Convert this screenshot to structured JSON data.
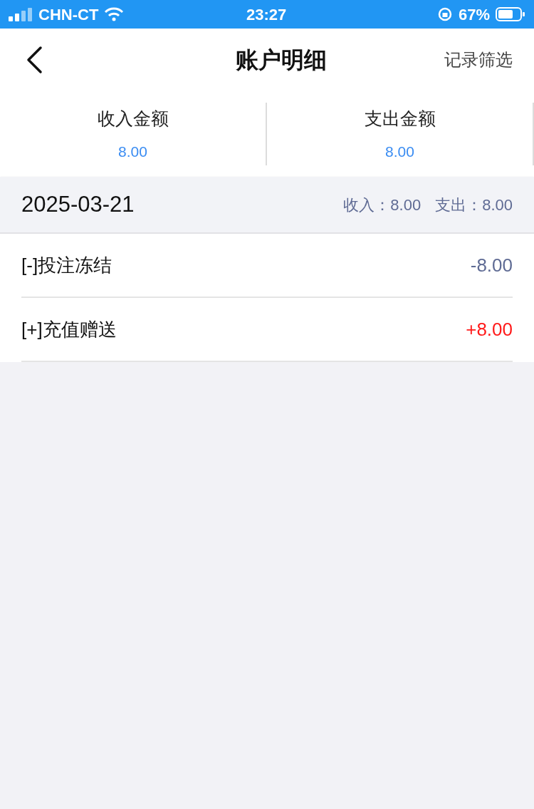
{
  "status_bar": {
    "carrier": "CHN-CT",
    "time": "23:27",
    "battery": "67%"
  },
  "header": {
    "title": "账户明细",
    "action": "记录筛选"
  },
  "summary": [
    {
      "label": "收入金额",
      "value": "8.00"
    },
    {
      "label": "支出金额",
      "value": "8.00"
    }
  ],
  "groups": [
    {
      "date": "2025-03-21",
      "income_label": "收入：",
      "income": "8.00",
      "expense_label": "支出：",
      "expense": "8.00",
      "records": [
        {
          "title": "[-]投注冻结",
          "amount": "-8.00",
          "kind": "expense"
        },
        {
          "title": "[+]充值赠送",
          "amount": "+8.00",
          "kind": "income"
        }
      ]
    }
  ]
}
